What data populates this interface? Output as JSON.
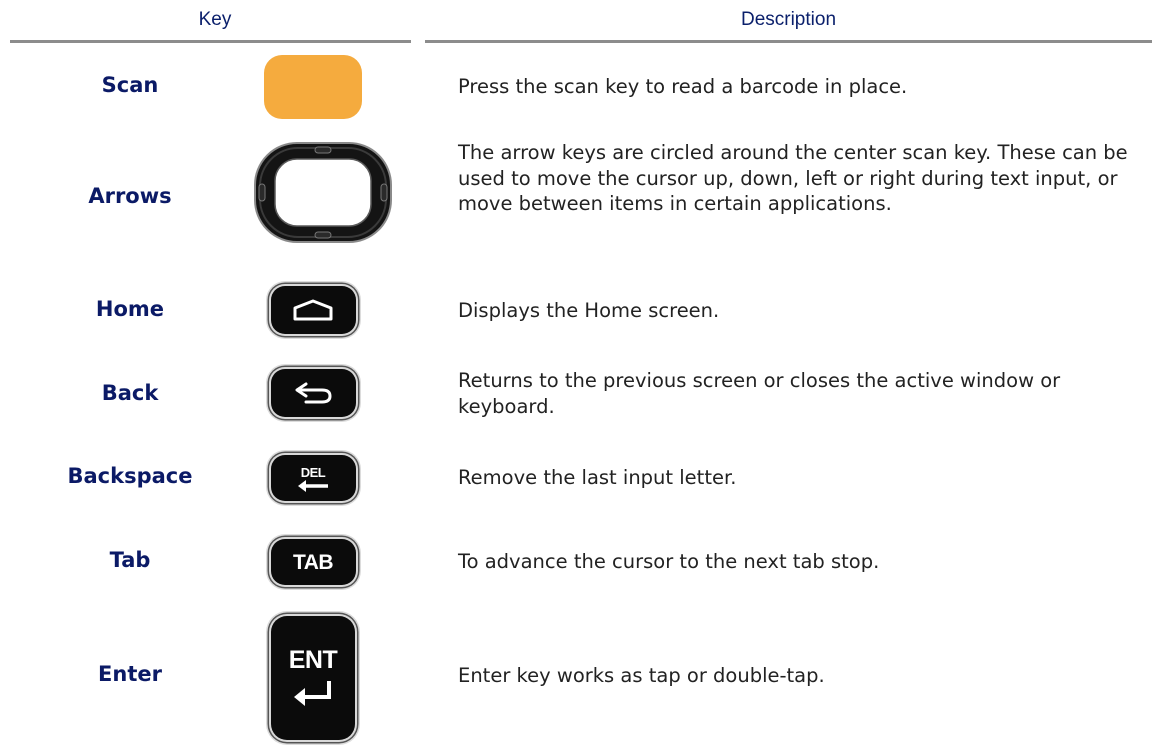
{
  "table": {
    "headers": {
      "key": "Key",
      "description": "Description"
    },
    "rows": [
      {
        "key": "Scan",
        "description": "Press the scan key to read a barcode in place."
      },
      {
        "key": "Arrows",
        "description": "The arrow keys are circled around the center scan key. These can be used to move the cursor up, down, left or right during text input, or move between items in certain applications."
      },
      {
        "key": "Home",
        "description": "Displays the Home screen."
      },
      {
        "key": "Back",
        "description": "Returns to the previous screen or closes the active window or keyboard."
      },
      {
        "key": "Backspace",
        "description": "Remove the last input letter."
      },
      {
        "key": "Tab",
        "description": "To advance the cursor to the next tab stop."
      },
      {
        "key": "Enter",
        "description": "Enter key works as tap or double-tap."
      }
    ]
  },
  "key_icons": {
    "scan": {
      "icon": "scan-key-icon",
      "color": "#f5ab3e"
    },
    "arrows": {
      "icon": "arrow-ring-icon"
    },
    "home": {
      "icon": "home-icon"
    },
    "back": {
      "icon": "back-arrow-icon"
    },
    "backspace": {
      "icon": "del-key-icon",
      "label": "DEL"
    },
    "tab": {
      "icon": "tab-key-icon",
      "label": "TAB"
    },
    "enter": {
      "icon": "ent-key-icon",
      "label": "ENT"
    }
  },
  "colors": {
    "header_text": "#0a1f6b",
    "key_name_text": "#0b1a66",
    "rule": "#8c8c8c"
  }
}
